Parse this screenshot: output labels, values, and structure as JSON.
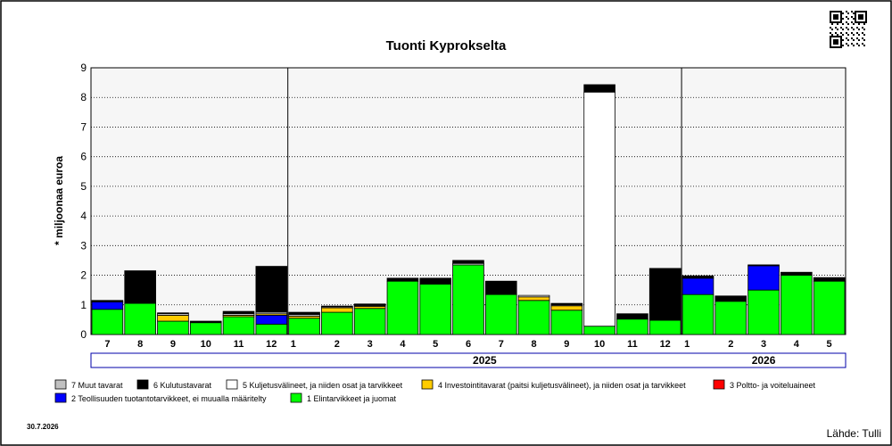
{
  "chart_data": {
    "type": "bar",
    "stacked": true,
    "title": "Tuonti Kyprokselta",
    "ylabel": "* miljoonaa euroa",
    "xlabel": "",
    "ylim": [
      0,
      9
    ],
    "yticks": [
      0,
      1,
      2,
      3,
      4,
      5,
      6,
      7,
      8,
      9
    ],
    "grid": true,
    "legend_position": "bottom",
    "categories": [
      "7",
      "8",
      "9",
      "10",
      "11",
      "12",
      "1",
      "2",
      "3",
      "4",
      "5",
      "6",
      "7",
      "8",
      "9",
      "10",
      "11",
      "12",
      "1",
      "2",
      "3",
      "4",
      "5"
    ],
    "year_groups": [
      {
        "label": "2025",
        "start": 6,
        "end": 17
      },
      {
        "label": "2026",
        "start": 18,
        "end": 22
      }
    ],
    "series": [
      {
        "name": "1 Elintarvikkeet ja juomat",
        "color": "#00ff00",
        "values": [
          0.85,
          1.05,
          0.45,
          0.4,
          0.6,
          0.35,
          0.55,
          0.75,
          0.88,
          1.8,
          1.7,
          2.35,
          1.35,
          1.15,
          0.82,
          0.28,
          0.52,
          0.48,
          1.35,
          1.12,
          1.5,
          2.0,
          1.8
        ]
      },
      {
        "name": "2 Teollisuuden tuotantotarvikkeet, ei muualla määritelty",
        "color": "#0000ff",
        "values": [
          0.25,
          0,
          0,
          0,
          0,
          0.3,
          0,
          0,
          0,
          0,
          0,
          0,
          0,
          0,
          0,
          0,
          0,
          0,
          0.55,
          0,
          0.82,
          0,
          0
        ]
      },
      {
        "name": "3 Poltto- ja voiteluaineet",
        "color": "#ff0000",
        "values": [
          0,
          0,
          0,
          0,
          0,
          0,
          0,
          0,
          0,
          0,
          0,
          0,
          0,
          0,
          0,
          0,
          0,
          0,
          0,
          0,
          0,
          0,
          0
        ]
      },
      {
        "name": "4 Investointitavarat (paitsi kuljetusvälineet), ja niiden osat ja tarvikkeet",
        "color": "#ffcc00",
        "values": [
          0,
          0,
          0.2,
          0,
          0.05,
          0.05,
          0.07,
          0.15,
          0.07,
          0,
          0,
          0,
          0,
          0.12,
          0.15,
          0,
          0,
          0,
          0,
          0,
          0,
          0,
          0
        ]
      },
      {
        "name": "5 Kuljetusvälineet, ja niiden osat ja tarvikkeet",
        "color": "#ffffff",
        "values": [
          0,
          0,
          0.05,
          0,
          0.05,
          0.05,
          0.05,
          0.03,
          0.03,
          0,
          0,
          0.05,
          0,
          0.05,
          0.03,
          7.9,
          0,
          0,
          0,
          0,
          0,
          0,
          0
        ]
      },
      {
        "name": "6 Kulutustavarat",
        "color": "#000000",
        "values": [
          0.05,
          1.1,
          0.03,
          0.05,
          0.08,
          1.55,
          0.08,
          0.03,
          0.05,
          0.1,
          0.2,
          0.1,
          0.45,
          0,
          0.05,
          0.25,
          0.18,
          1.75,
          0.08,
          0.18,
          0.03,
          0.1,
          0.12
        ]
      },
      {
        "name": "7 Muut tavarat",
        "color": "#c0c0c0",
        "values": [
          0,
          0,
          0,
          0,
          0,
          0,
          0,
          0,
          0,
          0,
          0,
          0,
          0,
          0,
          0,
          0,
          0,
          0,
          0,
          0,
          0,
          0,
          0
        ]
      }
    ],
    "legend_order": [
      6,
      5,
      4,
      3,
      2,
      1,
      0
    ]
  },
  "footer": {
    "date": "30.7.2026",
    "source": "Lähde: Tulli"
  },
  "qr_icon": "qr-code-icon"
}
